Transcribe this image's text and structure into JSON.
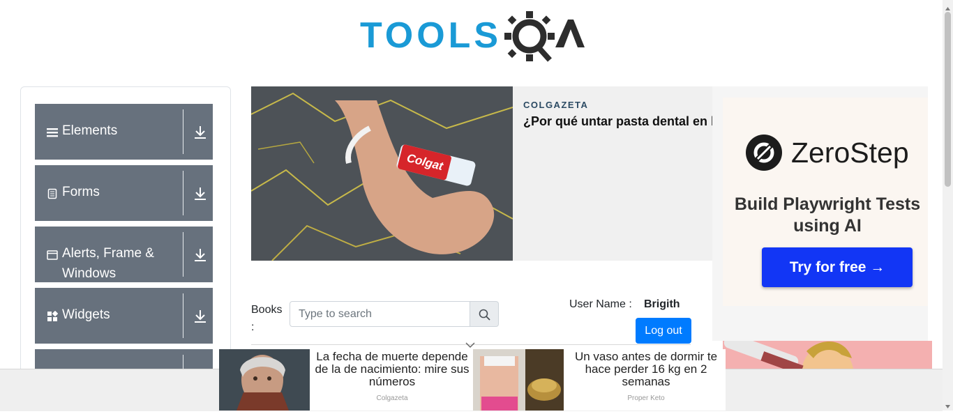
{
  "header": {
    "logo_text": "TOOLSQA",
    "logo_color": "#1a9ad6"
  },
  "sidebar": {
    "bg_color": "#67717d",
    "groups": [
      {
        "label": "Elements",
        "icon": "hamburger-icon"
      },
      {
        "label": "Forms",
        "icon": "document-icon"
      },
      {
        "label": "Alerts, Frame & Windows",
        "icon": "window-icon"
      },
      {
        "label": "Widgets",
        "icon": "widgets-icon"
      }
    ]
  },
  "ad_main": {
    "brand": "COLGAZETA",
    "headline": "¿Por qué untar pasta dental en l"
  },
  "zerostep": {
    "name": "ZeroStep",
    "tagline": "Build Playwright Tests using AI",
    "cta": "Try for free →",
    "cta_color": "#1236f5"
  },
  "books": {
    "label": "Books :",
    "search_placeholder": "Type to search",
    "user_name_label": "User Name :",
    "user_name_value": "Brigith",
    "logout_label": "Log out",
    "logout_color": "#007bff"
  },
  "bottom_ads": [
    {
      "title": "La fecha de muerte depende de la de nacimiento: mire sus números",
      "source": "Colgazeta"
    },
    {
      "title": "Un vaso antes de dormir te hace perder 16 kg en 2 semanas",
      "source": "Proper Keto"
    }
  ]
}
